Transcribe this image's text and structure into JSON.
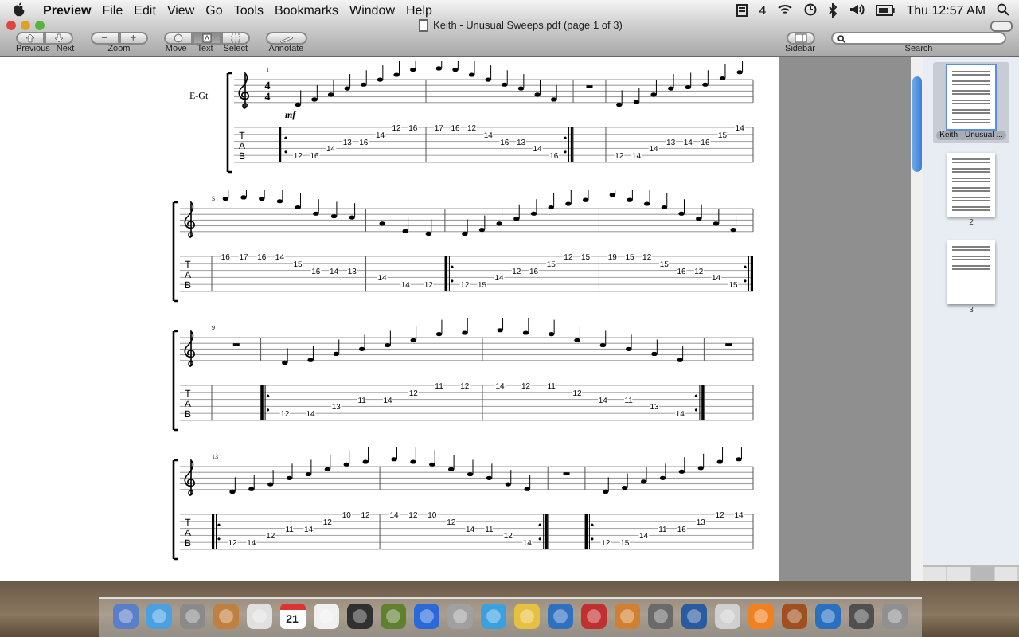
{
  "menu_bar": {
    "app": "Preview",
    "items": [
      "File",
      "Edit",
      "View",
      "Go",
      "Tools",
      "Bookmarks",
      "Window",
      "Help"
    ],
    "badge": "4",
    "clock": "Thu 12:57 AM"
  },
  "window": {
    "title": "Keith - Unusual Sweeps.pdf (page 1 of 3)"
  },
  "toolbar": {
    "nav": [
      "Previous",
      "Next"
    ],
    "zoom_buttons": [
      "−",
      "+"
    ],
    "zoom_label": "Zoom",
    "tools": [
      {
        "label": "Move",
        "selected": false
      },
      {
        "label": "Text",
        "selected": true
      },
      {
        "label": "Select",
        "selected": false
      }
    ],
    "annotate": "Annotate",
    "sidebar": "Sidebar",
    "search_label": "Search"
  },
  "document": {
    "systems": [
      {
        "instrument": "E-Gt",
        "time_signature": [
          "4",
          "4"
        ],
        "dynamic": "mf",
        "measure_number": "1",
        "tab_clef": [
          "T",
          "A",
          "B"
        ],
        "measures": [
          {
            "repeat_start": true,
            "repeat_end": false,
            "notes": [
              {
                "kind": "A",
                "text": "12"
              },
              {
                "kind": "A",
                "text": "16"
              },
              {
                "kind": "D",
                "text": "14"
              },
              {
                "kind": "G",
                "text": "13"
              },
              {
                "kind": "G",
                "text": "16"
              },
              {
                "kind": "B",
                "text": "14"
              },
              {
                "kind": "e",
                "text": "12"
              },
              {
                "kind": "e",
                "text": "16"
              }
            ]
          },
          {
            "repeat_start": false,
            "repeat_end": true,
            "notes": [
              {
                "kind": "e",
                "text": "17"
              },
              {
                "kind": "e",
                "text": "16"
              },
              {
                "kind": "e",
                "text": "12"
              },
              {
                "kind": "B",
                "text": "14"
              },
              {
                "kind": "G",
                "text": "16"
              },
              {
                "kind": "G",
                "text": "13"
              },
              {
                "kind": "D",
                "text": "14"
              },
              {
                "kind": "A",
                "text": "16"
              }
            ]
          },
          {
            "repeat_start": false,
            "repeat_end": false
          },
          {
            "repeat_start": false,
            "repeat_end": false,
            "notes": [
              {
                "kind": "A",
                "text": "12"
              },
              {
                "kind": "A",
                "text": "14"
              },
              {
                "kind": "D",
                "text": "14"
              },
              {
                "kind": "G",
                "text": "13"
              },
              {
                "kind": "G",
                "text": "14"
              },
              {
                "kind": "G",
                "text": "16"
              },
              {
                "kind": "B",
                "text": "15"
              },
              {
                "kind": "e",
                "text": "14"
              }
            ]
          }
        ]
      },
      {
        "measure_number": "5",
        "tab_clef": [
          "T",
          "A",
          "B"
        ],
        "measures": [
          {
            "repeat_start": false,
            "repeat_end": false,
            "notes": [
              {
                "kind": "e",
                "text": "16"
              },
              {
                "kind": "e",
                "text": "17"
              },
              {
                "kind": "e",
                "text": "16"
              },
              {
                "kind": "e",
                "text": "14"
              },
              {
                "kind": "B",
                "text": "15"
              },
              {
                "kind": "G",
                "text": "16"
              },
              {
                "kind": "G",
                "text": "14"
              },
              {
                "kind": "G",
                "text": "13"
              }
            ]
          },
          {
            "repeat_start": false,
            "repeat_end": false,
            "notes": [
              {
                "kind": "D",
                "text": "14"
              },
              {
                "kind": "A",
                "text": "14"
              },
              {
                "kind": "A",
                "text": "12"
              }
            ]
          },
          {
            "repeat_start": true,
            "repeat_end": false,
            "notes": [
              {
                "kind": "A",
                "text": "12"
              },
              {
                "kind": "A",
                "text": "15"
              },
              {
                "kind": "D",
                "text": "14"
              },
              {
                "kind": "G",
                "text": "12"
              },
              {
                "kind": "G",
                "text": "16"
              },
              {
                "kind": "B",
                "text": "15"
              },
              {
                "kind": "e",
                "text": "12"
              },
              {
                "kind": "e",
                "text": "15"
              }
            ]
          },
          {
            "repeat_start": false,
            "repeat_end": true,
            "notes": [
              {
                "kind": "e",
                "text": "19"
              },
              {
                "kind": "e",
                "text": "15"
              },
              {
                "kind": "e",
                "text": "12"
              },
              {
                "kind": "B",
                "text": "15"
              },
              {
                "kind": "G",
                "text": "16"
              },
              {
                "kind": "G",
                "text": "12"
              },
              {
                "kind": "D",
                "text": "14"
              },
              {
                "kind": "A",
                "text": "15"
              }
            ]
          }
        ]
      },
      {
        "measure_number": "9",
        "tab_clef": [
          "T",
          "A",
          "B"
        ],
        "measures": [
          {
            "repeat_start": false,
            "repeat_end": false
          },
          {
            "repeat_start": true,
            "repeat_end": false,
            "notes": [
              {
                "kind": "A",
                "text": "12"
              },
              {
                "kind": "A",
                "text": "14"
              },
              {
                "kind": "D",
                "text": "13"
              },
              {
                "kind": "G",
                "text": "11"
              },
              {
                "kind": "G",
                "text": "14"
              },
              {
                "kind": "B",
                "text": "12"
              },
              {
                "kind": "e",
                "text": "11"
              },
              {
                "kind": "e",
                "text": "12"
              }
            ]
          },
          {
            "repeat_start": false,
            "repeat_end": true,
            "notes": [
              {
                "kind": "e",
                "text": "14"
              },
              {
                "kind": "e",
                "text": "12"
              },
              {
                "kind": "e",
                "text": "11"
              },
              {
                "kind": "B",
                "text": "12"
              },
              {
                "kind": "G",
                "text": "14"
              },
              {
                "kind": "G",
                "text": "11"
              },
              {
                "kind": "D",
                "text": "13"
              },
              {
                "kind": "A",
                "text": "14"
              }
            ]
          },
          {
            "repeat_start": false,
            "repeat_end": false
          }
        ]
      },
      {
        "measure_number": "13",
        "tab_clef": [
          "T",
          "A",
          "B"
        ],
        "measures": [
          {
            "repeat_start": true,
            "repeat_end": false,
            "notes": [
              {
                "kind": "A",
                "text": "12"
              },
              {
                "kind": "A",
                "text": "14"
              },
              {
                "kind": "D",
                "text": "12"
              },
              {
                "kind": "G",
                "text": "11"
              },
              {
                "kind": "G",
                "text": "14"
              },
              {
                "kind": "B",
                "text": "12"
              },
              {
                "kind": "e",
                "text": "10"
              },
              {
                "kind": "e",
                "text": "12"
              }
            ]
          },
          {
            "repeat_start": false,
            "repeat_end": true,
            "notes": [
              {
                "kind": "e",
                "text": "14"
              },
              {
                "kind": "e",
                "text": "12"
              },
              {
                "kind": "e",
                "text": "10"
              },
              {
                "kind": "B",
                "text": "12"
              },
              {
                "kind": "G",
                "text": "14"
              },
              {
                "kind": "G",
                "text": "11"
              },
              {
                "kind": "D",
                "text": "12"
              },
              {
                "kind": "A",
                "text": "14"
              }
            ]
          },
          {
            "repeat_start": false,
            "repeat_end": false
          },
          {
            "repeat_start": true,
            "repeat_end": false,
            "notes": [
              {
                "kind": "A",
                "text": "12"
              },
              {
                "kind": "A",
                "text": "15"
              },
              {
                "kind": "D",
                "text": "14"
              },
              {
                "kind": "G",
                "text": "11"
              },
              {
                "kind": "G",
                "text": "16"
              },
              {
                "kind": "B",
                "text": "13"
              },
              {
                "kind": "e",
                "text": "12"
              },
              {
                "kind": "e",
                "text": "14"
              }
            ]
          }
        ]
      }
    ]
  },
  "sidebar": {
    "pages": [
      {
        "caption": "Keith - Unusual ...",
        "selected": true
      },
      {
        "caption": "2",
        "selected": false
      },
      {
        "caption": "3",
        "selected": false
      }
    ]
  },
  "dock": {
    "calendar_day": "21"
  }
}
